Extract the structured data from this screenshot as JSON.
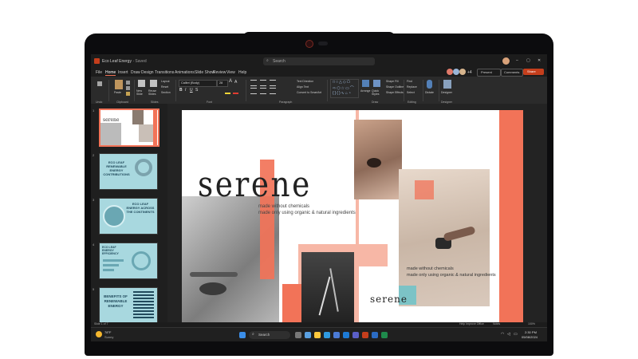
{
  "app": {
    "doc_title": "Eco Leaf Energy",
    "doc_suffix": "Saved",
    "search_placeholder": "Search",
    "collab_count": "+4",
    "present_label": "Present",
    "comments_label": "Comments",
    "share_label": "Share"
  },
  "menu": [
    "File",
    "Home",
    "Insert",
    "Draw",
    "Design",
    "Transitions",
    "Animations",
    "Slide Show",
    "Review",
    "View",
    "Help"
  ],
  "ribbon": {
    "groups": [
      "Undo",
      "Clipboard",
      "Slides",
      "Font",
      "Paragraph",
      "Draw",
      "Editing",
      "Designer"
    ],
    "font_name": "Calibri (Body)",
    "font_size": "28",
    "buttons": {
      "paste": "Paste",
      "new_slide": "New Slide",
      "reuse_slides": "Reuse Slides",
      "layout": "Layout",
      "reset": "Reset",
      "section": "Section",
      "text_direction": "Text Direction",
      "align_text": "Align Text",
      "convert_smartart": "Convert to SmartArt",
      "arrange": "Arrange",
      "quick_styles": "Quick Styles",
      "shape_fill": "Shape Fill",
      "shape_outline": "Shape Outline",
      "shape_effects": "Shape Effects",
      "find": "Find",
      "replace": "Replace",
      "select": "Select",
      "dictate": "Dictate",
      "designer": "Designer"
    }
  },
  "thumbnails": [
    {
      "num": "1",
      "text": "serene"
    },
    {
      "num": "2",
      "text": "ECO LEAF RENEWABLE ENERGY CONTRIBUTIONS"
    },
    {
      "num": "3",
      "text": "ECO LEAF ENERGY ACROSS THE CONTINENTS"
    },
    {
      "num": "4",
      "text": "ECO LEAF ENERGY EFFICIENCY"
    },
    {
      "num": "5",
      "text": "BENEFITS OF RENEWABLE ENERGY"
    }
  ],
  "slide": {
    "title": "serene",
    "tagline_1": "made without chemicals",
    "tagline_2": "made only using organic & natural ingredients",
    "caption_1": "made without chemicals",
    "caption_2": "made only using organic & natural ingredients",
    "brand_small": "serene"
  },
  "status": {
    "slide_info": "Slide 1 of 7",
    "help_text": "Help Improve Office",
    "notes": "Notes",
    "zoom": "100%"
  },
  "taskbar": {
    "weather_temp": "78°F",
    "weather_desc": "Sunny",
    "search_label": "Search",
    "time": "2:30 PM",
    "date": "05/08/2024"
  },
  "colors": {
    "accent_coral": "#f27358",
    "accent_pink": "#f7b7a6",
    "office_red": "#c43e1c",
    "teal": "#6cc3c9"
  }
}
